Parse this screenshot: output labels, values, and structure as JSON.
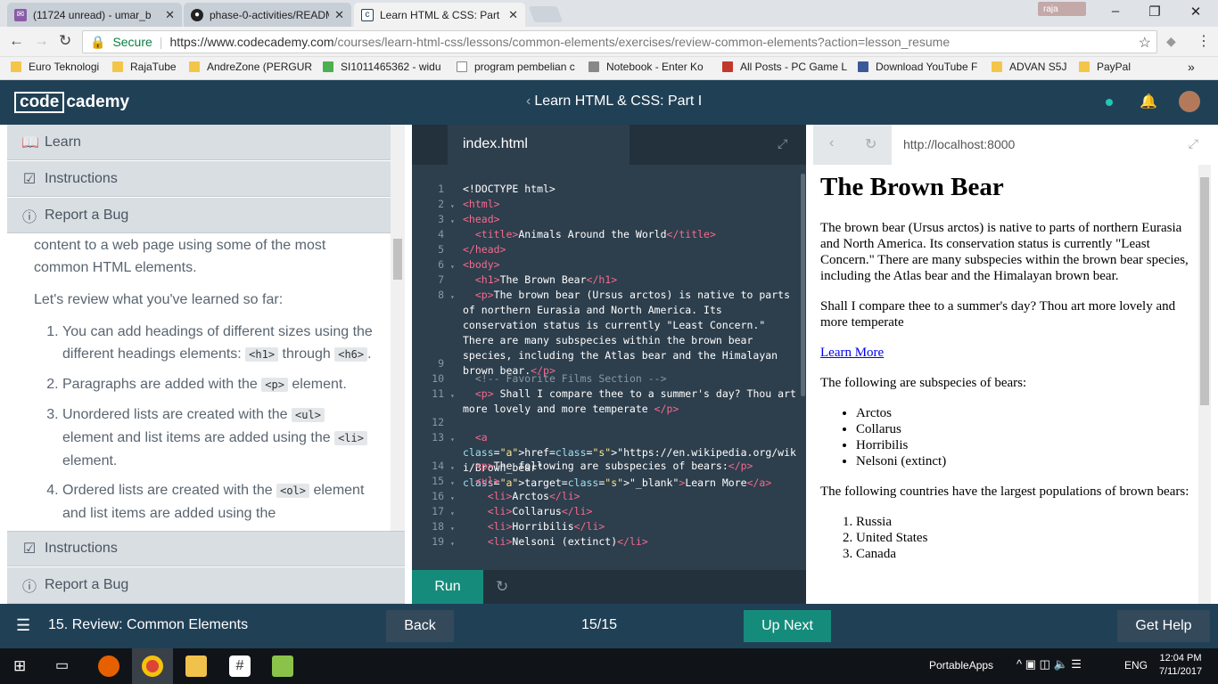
{
  "browser": {
    "tabs": [
      {
        "title": "(11724 unread) - umar_b",
        "favicon": "mail-icon"
      },
      {
        "title": "phase-0-activities/READM",
        "favicon": "github-icon"
      },
      {
        "title": "Learn HTML & CSS: Part I",
        "favicon": "codecademy-icon"
      }
    ],
    "user_chip": "raja",
    "secure_label": "Secure",
    "url_host": "https://www.codecademy.com",
    "url_path": "/courses/learn-html-css/lessons/common-elements/exercises/review-common-elements?action=lesson_resume",
    "bookmarks": [
      "Euro Teknologi",
      "RajaTube",
      "AndreZone (PERGUR",
      "SI1011465362 - widu",
      "program pembelian c",
      "Notebook - Enter Ko",
      "All Posts - PC Game L",
      "Download YouTube F",
      "ADVAN S5J",
      "PayPal"
    ],
    "bookmarks_more": "»"
  },
  "header": {
    "logo_box": "code",
    "logo_rest": "cademy",
    "course_title": "Learn HTML & CSS: Part I"
  },
  "left": {
    "learn": "Learn",
    "instructions": "Instructions",
    "report_bug": "Report a Bug",
    "intro": "content to a web page using some of the most common HTML elements.",
    "review_lead": "Let's review what you've learned so far:",
    "items": [
      {
        "pre": "You can add headings of different sizes using the different headings elements: ",
        "code1": "<h1>",
        "mid": " through ",
        "code2": "<h6>",
        "post": "."
      },
      {
        "pre": "Paragraphs are added with the ",
        "code1": "<p>",
        "post": " element."
      },
      {
        "pre": "Unordered lists are created with the ",
        "code1": "<ul>",
        "mid": " element and list items are added using the ",
        "code2": "<li>",
        "post": " element."
      },
      {
        "pre": "Ordered lists are created with the ",
        "code1": "<ol>",
        "post": " element and list items are added using the"
      }
    ],
    "instructions_bottom": "Instructions",
    "report_bug_bottom": "Report a Bug"
  },
  "editor": {
    "filename": "index.html",
    "run_label": "Run",
    "lines": [
      {
        "n": "1",
        "arrow": "",
        "text": "<!DOCTYPE html>"
      },
      {
        "n": "2",
        "arrow": "▾",
        "text": "<html>"
      },
      {
        "n": "3",
        "arrow": "▾",
        "text": "<head>"
      },
      {
        "n": "4",
        "arrow": "",
        "text": "  <title>Animals Around the World</title>"
      },
      {
        "n": "5",
        "arrow": "",
        "text": "</head>"
      },
      {
        "n": "6",
        "arrow": "▾",
        "text": "<body>"
      },
      {
        "n": "7",
        "arrow": "",
        "text": "  <h1>The Brown Bear</h1>"
      },
      {
        "n": "8",
        "arrow": "▾",
        "text": "  <p>The brown bear (Ursus arctos) is native to parts of northern Eurasia and North America. Its conservation status is currently \"Least Concern.\" There are many subspecies within the brown bear species, including the Atlas bear and the Himalayan brown bear.</p>"
      },
      {
        "n": "9",
        "arrow": "",
        "text": ""
      },
      {
        "n": "10",
        "arrow": "",
        "text": "  <!-- Favorite Films Section -->"
      },
      {
        "n": "11",
        "arrow": "▾",
        "text": "  <p> Shall I compare thee to a summer's day? Thou art more lovely and more temperate </p>"
      },
      {
        "n": "12",
        "arrow": "",
        "text": ""
      },
      {
        "n": "13",
        "arrow": "▾",
        "text": "  <a href=\"https://en.wikipedia.org/wiki/Brown_bear\" target=\"_blank\">Learn More</a>"
      },
      {
        "n": "14",
        "arrow": "▾",
        "text": "  <p>The following are subspecies of bears:</p>"
      },
      {
        "n": "15",
        "arrow": "▾",
        "text": "  <ul>"
      },
      {
        "n": "16",
        "arrow": "▾",
        "text": "    <li>Arctos</li>"
      },
      {
        "n": "17",
        "arrow": "▾",
        "text": "    <li>Collarus</li>"
      },
      {
        "n": "18",
        "arrow": "▾",
        "text": "    <li>Horribilis</li>"
      },
      {
        "n": "19",
        "arrow": "▾",
        "text": "    <li>Nelsoni (extinct)</li>"
      }
    ]
  },
  "preview": {
    "url": "http://localhost:8000",
    "h1": "The Brown Bear",
    "p1": "The brown bear (Ursus arctos) is native to parts of northern Eurasia and North America. Its conservation status is currently \"Least Concern.\" There are many subspecies within the brown bear species, including the Atlas bear and the Himalayan brown bear.",
    "p2": "Shall I compare thee to a summer's day? Thou art more lovely and more temperate",
    "link": "Learn More",
    "p3": "The following are subspecies of bears:",
    "ul": [
      "Arctos",
      "Collarus",
      "Horribilis",
      "Nelsoni (extinct)"
    ],
    "p4": "The following countries have the largest populations of brown bears:",
    "ol": [
      "Russia",
      "United States",
      "Canada"
    ]
  },
  "footer": {
    "lesson": "15. Review: Common Elements",
    "back": "Back",
    "progress": "15/15",
    "up_next": "Up Next",
    "get_help": "Get Help"
  },
  "taskbar": {
    "portable_apps": "PortableApps",
    "lang": "ENG",
    "time": "12:04 PM",
    "date": "7/11/2017"
  },
  "colors": {
    "header_bg": "#204056",
    "accent_teal": "#158c7b",
    "editor_bg": "#2d3e4c",
    "tag_pink": "#f56b8e"
  }
}
